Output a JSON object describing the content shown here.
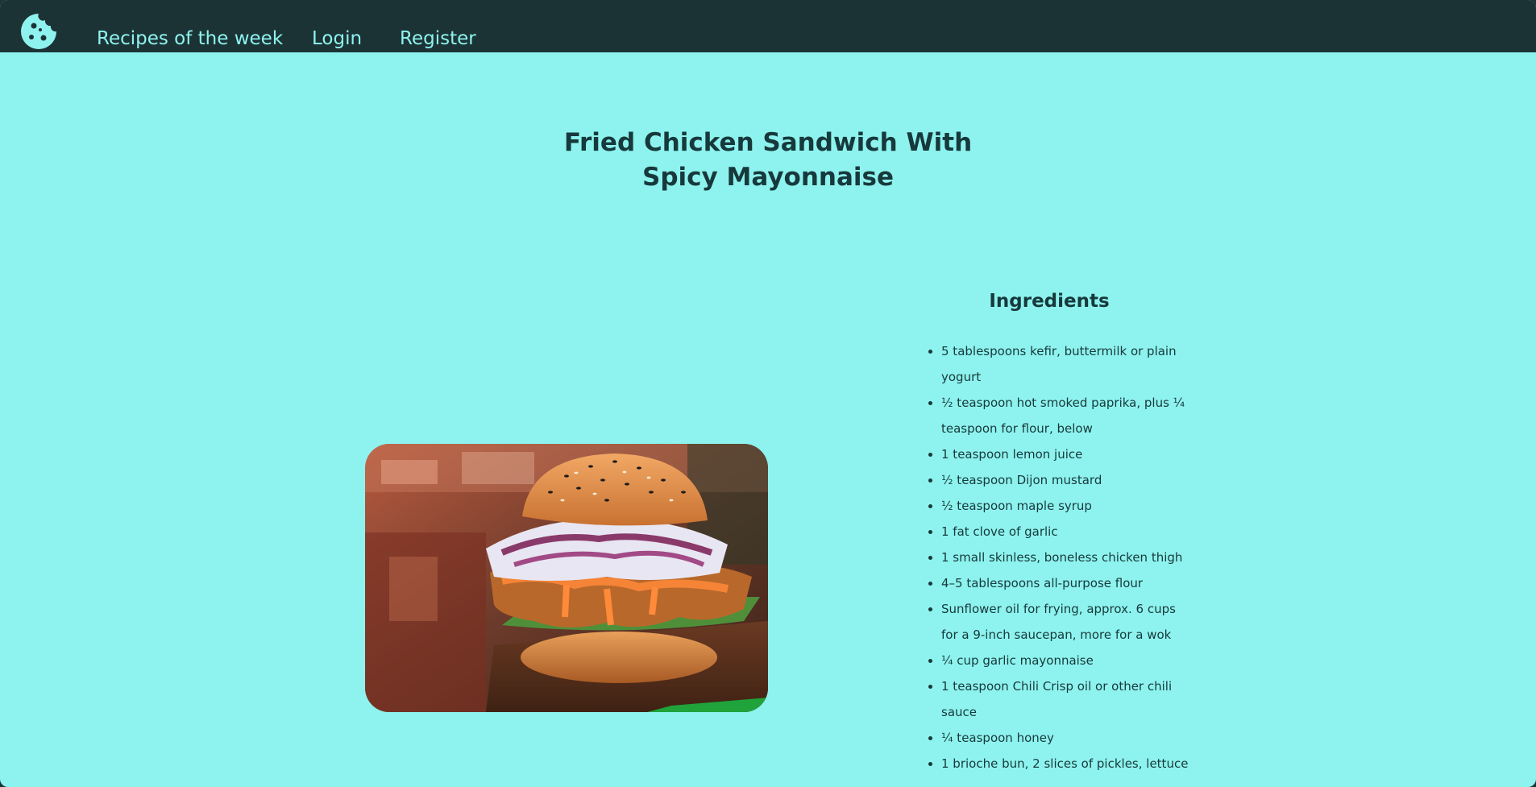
{
  "nav": {
    "logo_icon": "cookie-icon",
    "links": [
      "Recipes of the week",
      "Login",
      "Register"
    ]
  },
  "recipe": {
    "title": "Fried Chicken Sandwich With Spicy Mayonnaise",
    "image_icon": "fried-chicken-sandwich-photo"
  },
  "ingredients": {
    "heading": "Ingredients",
    "items": [
      "5 tablespoons kefir, buttermilk or plain yogurt",
      "½ teaspoon hot smoked paprika, plus ¼ teaspoon for flour, below",
      "1 teaspoon lemon juice",
      "½ teaspoon Dijon mustard",
      "½ teaspoon maple syrup",
      "1 fat clove of garlic",
      "1 small skinless, boneless chicken thigh",
      "4–5 tablespoons all-purpose flour",
      "Sunflower oil for frying, approx. 6 cups for a 9-inch saucepan, more for a wok",
      "¼ cup garlic mayonnaise",
      "1 teaspoon Chili Crisp oil or other chili sauce",
      "¼ teaspoon honey",
      "1 brioche bun, 2 slices of pickles, lettuce"
    ]
  },
  "colors": {
    "background": "#8ef3ee",
    "navbar": "#1c3336",
    "text": "#17393c",
    "nav_link": "#8ef3ee"
  }
}
